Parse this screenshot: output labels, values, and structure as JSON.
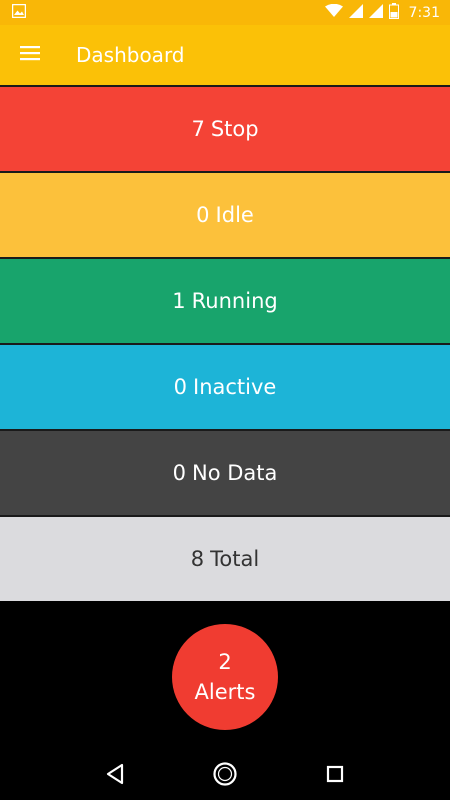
{
  "status_bar": {
    "time": "7:31",
    "icons": [
      "image-notification-icon",
      "wifi-icon",
      "signal-icon",
      "signal-icon",
      "battery-icon"
    ]
  },
  "app_bar": {
    "title": "Dashboard",
    "menu_icon": "hamburger-menu-icon"
  },
  "tiles": [
    {
      "count": "7",
      "label": "Stop",
      "color": "#F44336",
      "text_color": "#FFFFFF"
    },
    {
      "count": "0",
      "label": "Idle",
      "color": "#FCC13B",
      "text_color": "#FFFFFF"
    },
    {
      "count": "1",
      "label": "Running",
      "color": "#18A46C",
      "text_color": "#FFFFFF"
    },
    {
      "count": "0",
      "label": "Inactive",
      "color": "#1DB4D7",
      "text_color": "#FFFFFF"
    },
    {
      "count": "0",
      "label": "No Data",
      "color": "#444444",
      "text_color": "#FFFFFF"
    },
    {
      "count": "8",
      "label": "Total",
      "color": "#DBDBDE",
      "text_color": "#333333"
    }
  ],
  "alerts": {
    "count": "2",
    "label": "Alerts",
    "color": "#F03C31"
  },
  "nav_bar": {
    "icons": [
      "back-icon",
      "home-icon",
      "recents-icon"
    ]
  }
}
